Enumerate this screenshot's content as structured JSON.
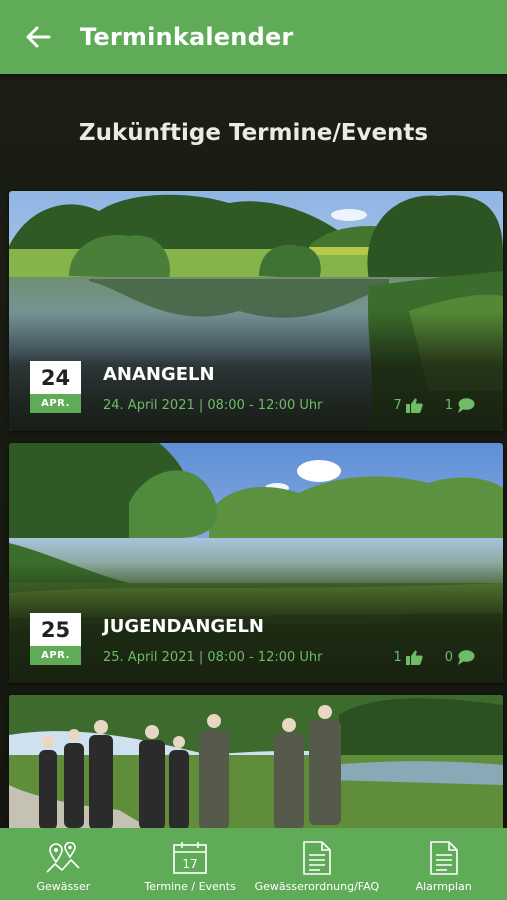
{
  "app_bar": {
    "title": "Terminkalender"
  },
  "section": {
    "title": "Zukünftige Termine/Events"
  },
  "events": [
    {
      "day": "24",
      "month": "APR.",
      "title": "ANANGELN",
      "date_text": "24. April 2021 | 08:00 - 12:00 Uhr",
      "likes": "7",
      "comments": "1"
    },
    {
      "day": "25",
      "month": "APR.",
      "title": "JUGENDANGELN",
      "date_text": "25. April 2021 | 08:00 - 12:00 Uhr",
      "likes": "1",
      "comments": "0"
    }
  ],
  "bottom_nav": [
    {
      "label": "Gewässer",
      "icon": "map-pins-icon"
    },
    {
      "label": "Termine / Events",
      "icon": "calendar-icon",
      "calendar_day": "17"
    },
    {
      "label": "Gewässerordnung/FAQ",
      "icon": "document-icon"
    },
    {
      "label": "Alarmplan",
      "icon": "document-icon"
    }
  ],
  "colors": {
    "primary_green": "#5fab58",
    "accent_text_green": "#6fbb66",
    "background": "#15170f"
  }
}
